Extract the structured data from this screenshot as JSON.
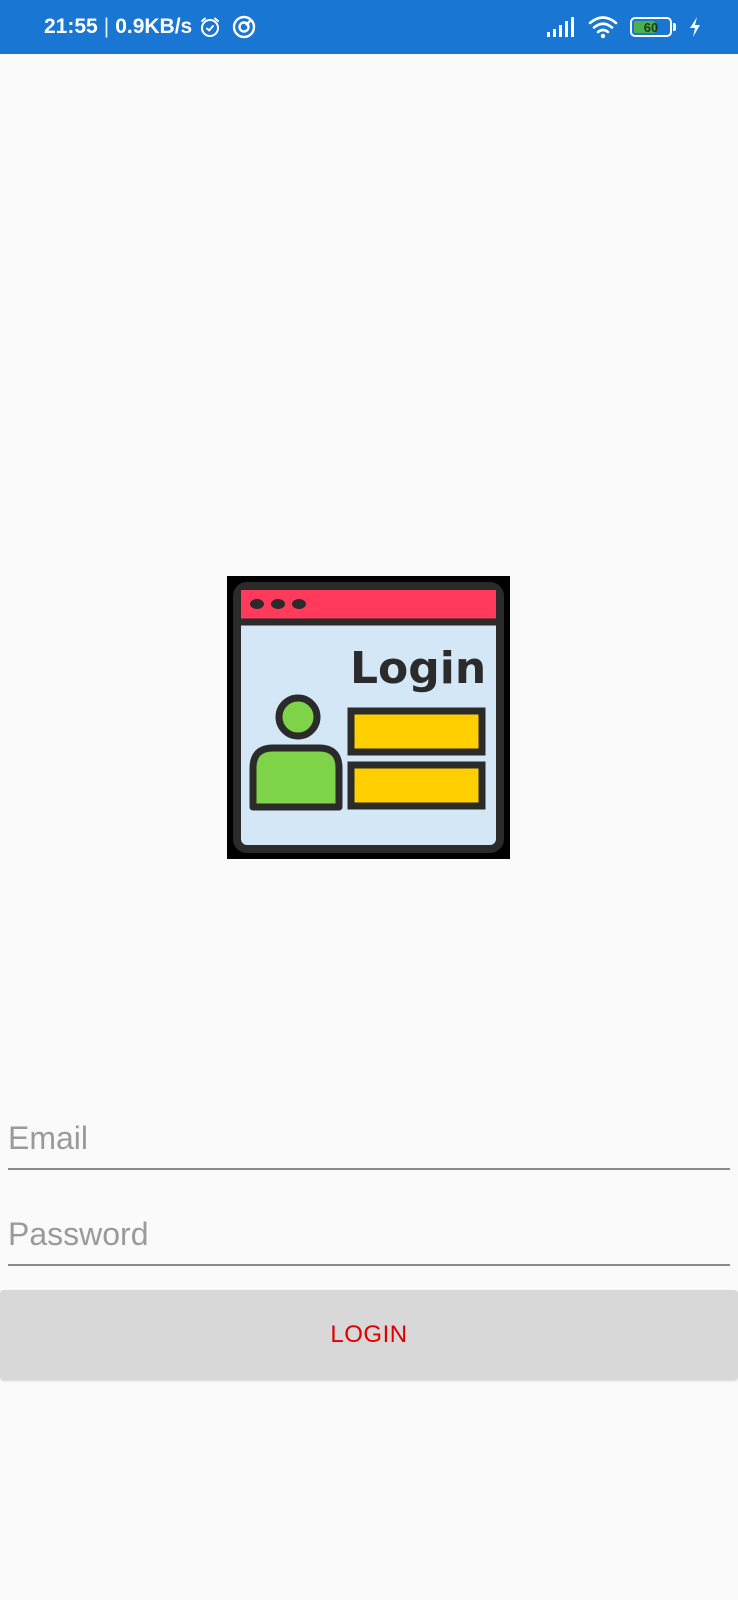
{
  "status_bar": {
    "time": "21:55",
    "separator": "|",
    "net_speed": "0.9KB/s",
    "icons": [
      "alarm-icon",
      "sync-icon",
      "signal-icon",
      "wifi-icon",
      "battery-icon",
      "charging-icon"
    ],
    "battery_level": "60",
    "background_color": "#1976d2"
  },
  "logo": {
    "text": "Login",
    "icon": "login-illustration-icon",
    "colors": {
      "title_bar": "#ff3a5a",
      "window": "#d4e7f7",
      "user": "#7ed348",
      "fields": "#ffcf00",
      "outline": "#2b2b2b"
    }
  },
  "form": {
    "email": {
      "placeholder": "Email",
      "value": ""
    },
    "password": {
      "placeholder": "Password",
      "value": ""
    },
    "login_button": {
      "label": "LOGIN",
      "text_color": "#e00000",
      "background_color": "#d8d8d8"
    }
  }
}
